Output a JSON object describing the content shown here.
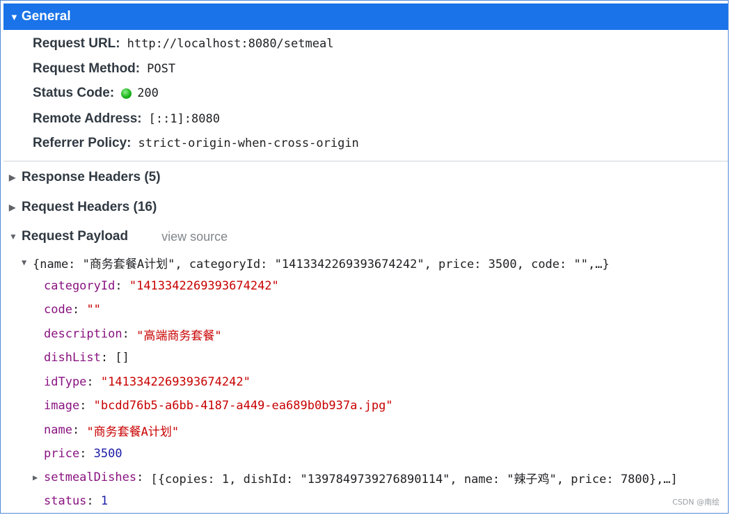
{
  "general": {
    "title": "General",
    "rows": [
      {
        "label": "Request URL:",
        "value": "http://localhost:8080/setmeal"
      },
      {
        "label": "Request Method:",
        "value": "POST"
      },
      {
        "label": "Status Code:",
        "value": "200"
      },
      {
        "label": "Remote Address:",
        "value": "[::1]:8080"
      },
      {
        "label": "Referrer Policy:",
        "value": "strict-origin-when-cross-origin"
      }
    ],
    "status_color": "#1db41d"
  },
  "sections": {
    "response_headers": "Response Headers (5)",
    "request_headers": "Request Headers (16)",
    "request_payload": "Request Payload",
    "view_source": "view source"
  },
  "payload": {
    "summary": "{name: \"商务套餐A计划\", categoryId: \"1413342269393674242\", price: 3500, code: \"\",…}",
    "fields": [
      {
        "key": "categoryId",
        "value": "\"1413342269393674242\"",
        "kind": "string"
      },
      {
        "key": "code",
        "value": "\"\"",
        "kind": "string"
      },
      {
        "key": "description",
        "value": "\"高端商务套餐\"",
        "kind": "string"
      },
      {
        "key": "dishList",
        "value": "[]",
        "kind": "plain"
      },
      {
        "key": "idType",
        "value": "\"1413342269393674242\"",
        "kind": "string"
      },
      {
        "key": "image",
        "value": "\"bcdd76b5-a6bb-4187-a449-ea689b0b937a.jpg\"",
        "kind": "string"
      },
      {
        "key": "name",
        "value": "\"商务套餐A计划\"",
        "kind": "string"
      },
      {
        "key": "price",
        "value": "3500",
        "kind": "number"
      },
      {
        "key": "setmealDishes",
        "value": "[{copies: 1, dishId: \"1397849739276890114\", name: \"辣子鸡\", price: 7800},…]",
        "kind": "plain"
      },
      {
        "key": "status",
        "value": "1",
        "kind": "number"
      }
    ]
  },
  "watermark": "CSDN @南绘",
  "icons": {
    "expanded": "triangle-down-icon",
    "collapsed": "triangle-right-icon",
    "status": "status-dot-icon"
  }
}
